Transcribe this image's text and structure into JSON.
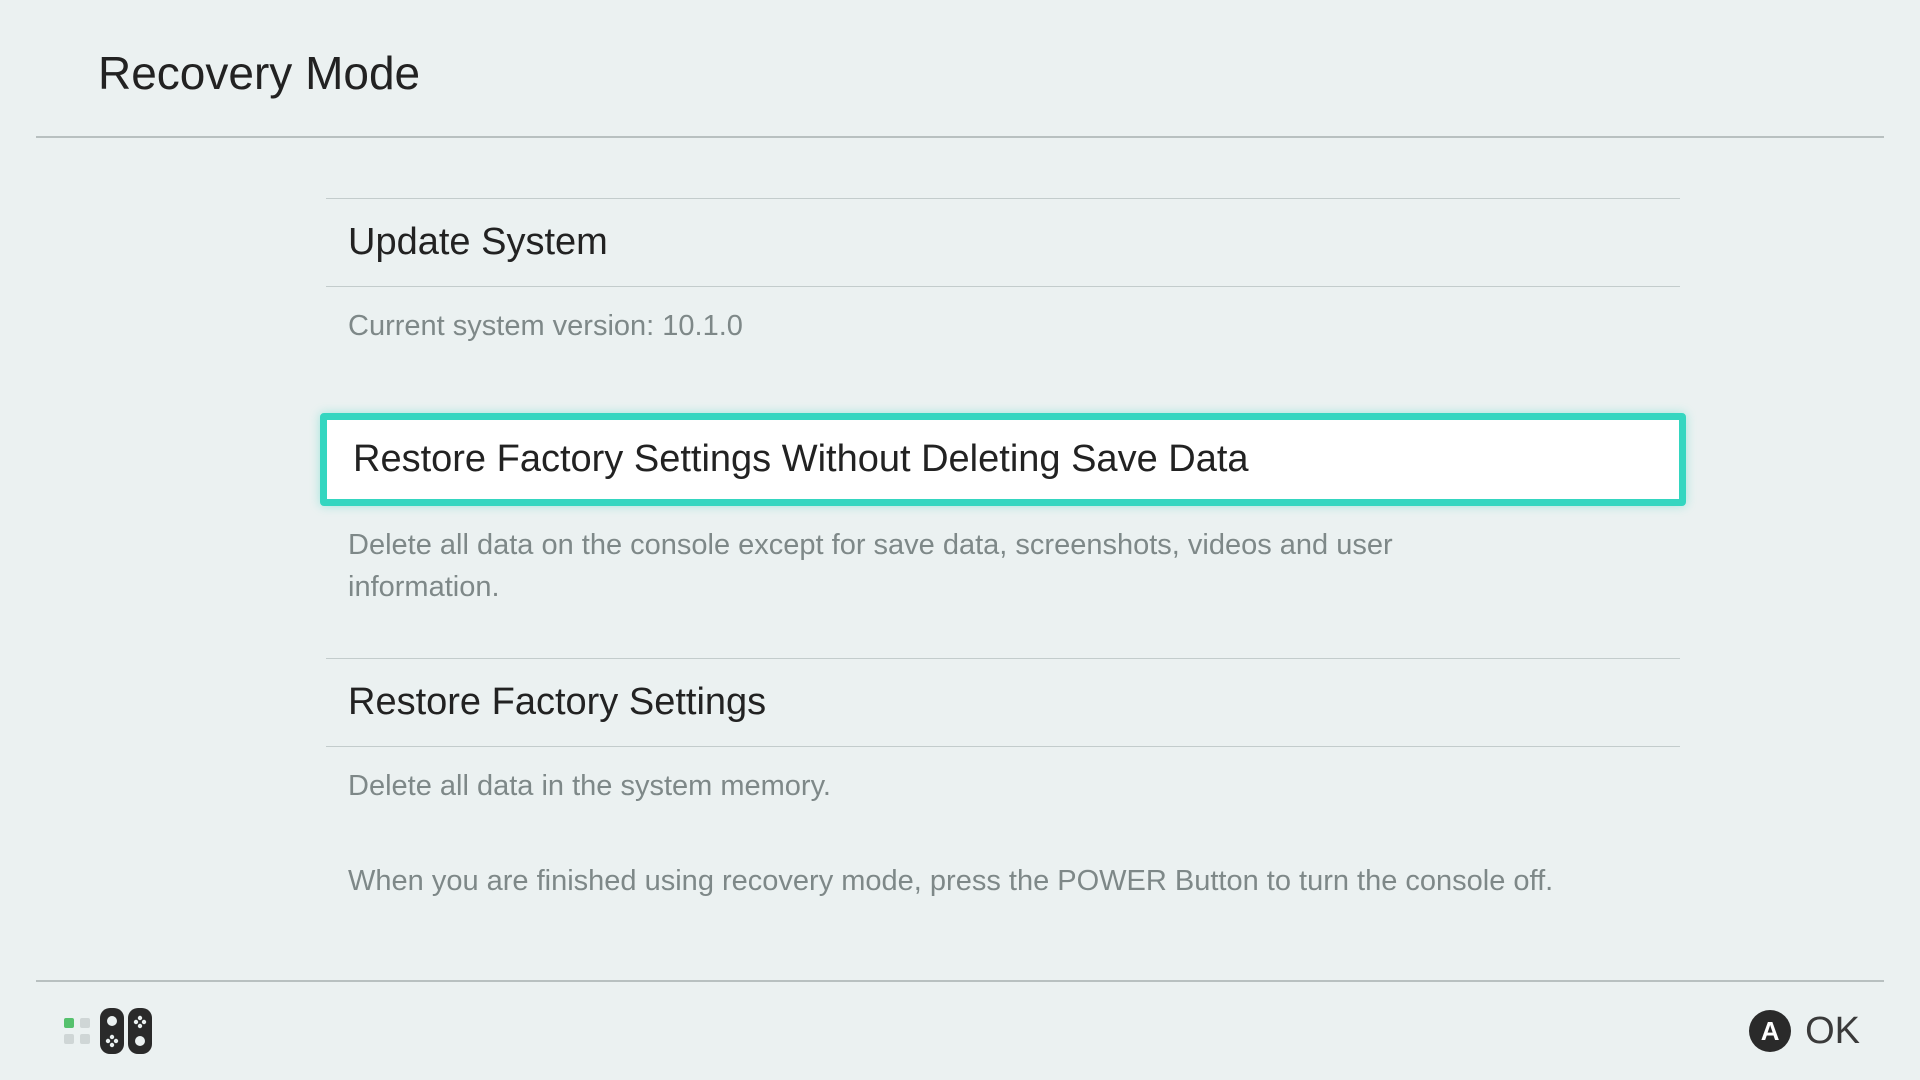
{
  "header": {
    "title": "Recovery Mode"
  },
  "options": {
    "update": {
      "title": "Update System",
      "desc": "Current system version: 10.1.0"
    },
    "restoreKeepSave": {
      "title": "Restore Factory Settings Without Deleting Save Data",
      "desc": "Delete all data on the console except for save data, screenshots, videos and user information."
    },
    "restoreFull": {
      "title": "Restore Factory Settings",
      "desc": "Delete all data in the system memory."
    }
  },
  "exitNote": "When you are finished using recovery mode, press the POWER Button to turn the console off.",
  "footer": {
    "okButtonGlyph": "A",
    "okLabel": "OK"
  }
}
